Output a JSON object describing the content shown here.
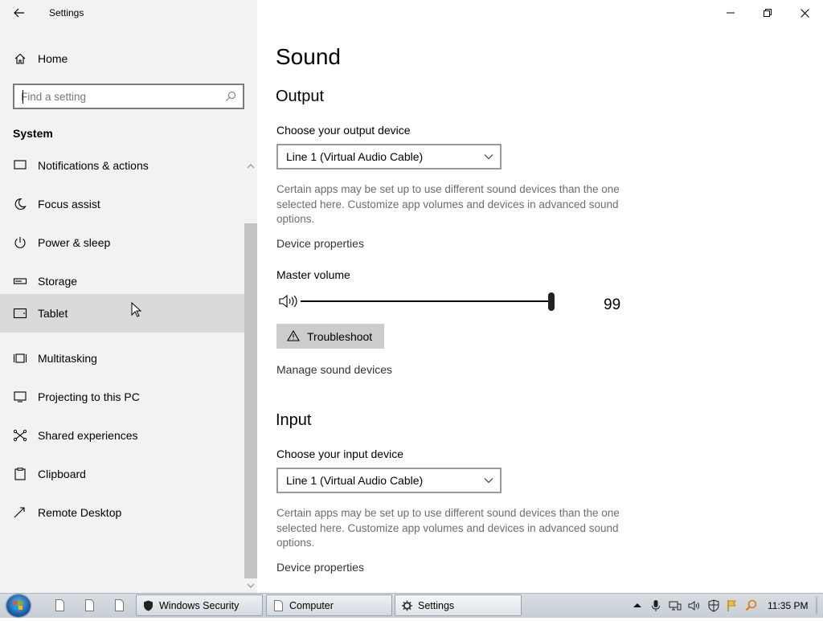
{
  "window": {
    "title": "Settings",
    "controls": [
      "minimize",
      "restore",
      "close"
    ]
  },
  "sidebar": {
    "home_label": "Home",
    "search_placeholder": "Find a setting",
    "section": "System",
    "items": [
      {
        "label": "Notifications & actions",
        "icon": "message-icon"
      },
      {
        "label": "Focus assist",
        "icon": "moon-icon"
      },
      {
        "label": "Power & sleep",
        "icon": "power-icon"
      },
      {
        "label": "Storage",
        "icon": "storage-icon"
      },
      {
        "label": "Tablet",
        "icon": "tablet-icon"
      },
      {
        "label": "Multitasking",
        "icon": "multitasking-icon"
      },
      {
        "label": "Projecting to this PC",
        "icon": "projector-icon"
      },
      {
        "label": "Shared experiences",
        "icon": "share-icon"
      },
      {
        "label": "Clipboard",
        "icon": "clipboard-icon"
      },
      {
        "label": "Remote Desktop",
        "icon": "remote-desktop-icon"
      }
    ]
  },
  "main": {
    "title": "Sound",
    "output": {
      "heading": "Output",
      "device_label": "Choose your output device",
      "device_value": "Line 1 (Virtual Audio Cable)",
      "description": "Certain apps may be set up to use different sound devices than the one selected here. Customize app volumes and devices in advanced sound options.",
      "device_properties": "Device properties",
      "master_volume_label": "Master volume",
      "volume": "99",
      "troubleshoot": "Troubleshoot",
      "manage_devices": "Manage sound devices"
    },
    "input": {
      "heading": "Input",
      "device_label": "Choose your input device",
      "device_value": "Line 1 (Virtual Audio Cable)",
      "description": "Certain apps may be set up to use different sound devices than the one selected here. Customize app volumes and devices in advanced sound options.",
      "device_properties": "Device properties"
    }
  },
  "taskbar": {
    "buttons": [
      {
        "label": "Windows Security",
        "icon": "shield-icon"
      },
      {
        "label": "Computer",
        "icon": "document-icon"
      },
      {
        "label": "Settings",
        "icon": "gear-icon"
      }
    ],
    "clock": "11:35 PM"
  },
  "colors": {
    "sidebar_bg": "#f2f2f2",
    "hover_bg": "#dadada",
    "button_bg": "#cccccc",
    "secondary_text": "#6d6d6d"
  }
}
